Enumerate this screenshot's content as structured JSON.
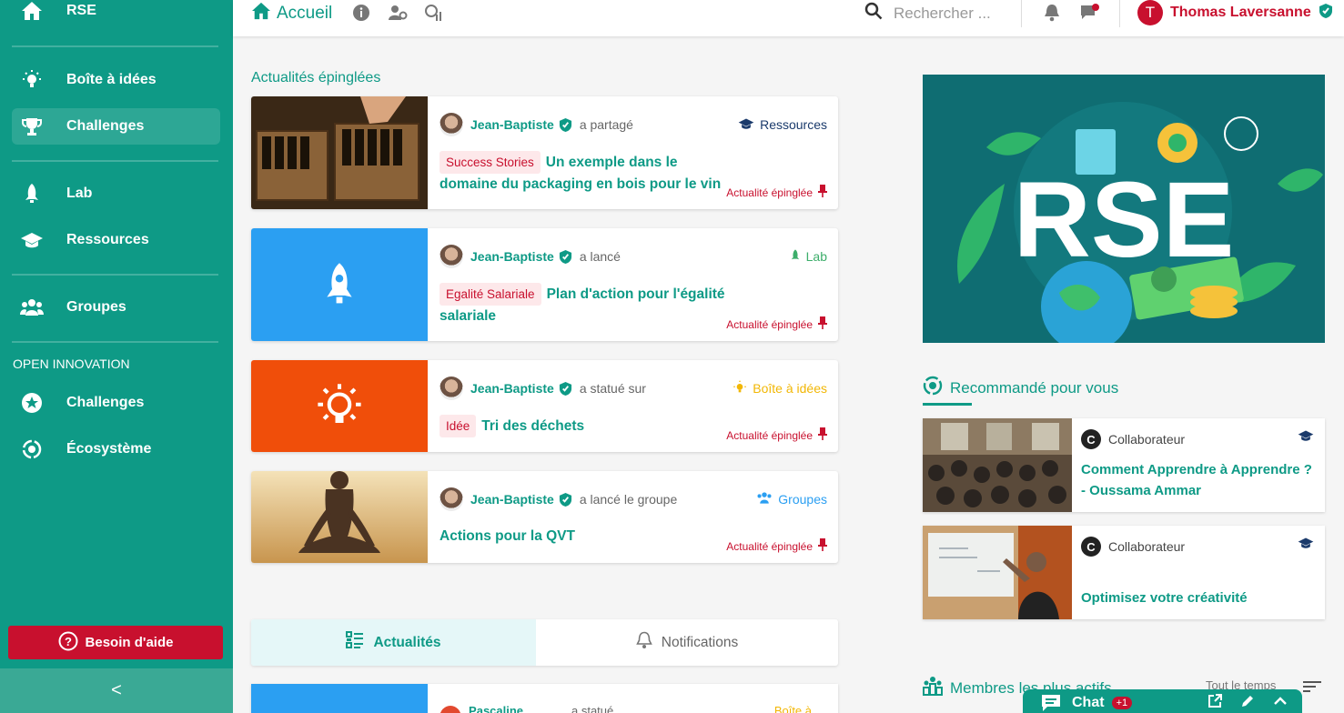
{
  "sidebar": {
    "title": "RSE",
    "items": [
      {
        "label": "Boîte à idées",
        "icon": "lightbulb-icon"
      },
      {
        "label": "Challenges",
        "icon": "trophy-icon"
      },
      {
        "label": "Lab",
        "icon": "rocket-icon"
      },
      {
        "label": "Ressources",
        "icon": "graduation-cap-icon"
      },
      {
        "label": "Groupes",
        "icon": "users-icon"
      }
    ],
    "section_label": "OPEN INNOVATION",
    "section_items": [
      {
        "label": "Challenges",
        "icon": "star-circle-icon"
      },
      {
        "label": "Écosystème",
        "icon": "ecosystem-icon"
      }
    ],
    "help_label": "Besoin d'aide",
    "collapse_glyph": "<"
  },
  "topbar": {
    "home_label": "Accueil",
    "search_placeholder": "Rechercher ...",
    "user_initial": "T",
    "user_name": "Thomas Laversanne"
  },
  "pinned": {
    "title": "Actualités épinglées",
    "pinned_label": "Actualité épinglée",
    "cards": [
      {
        "author": "Jean-Baptiste",
        "action": "a partagé",
        "category": "Ressources",
        "tag": "Success Stories",
        "title": "Un exemple dans le domaine du packaging en bois pour le vin"
      },
      {
        "author": "Jean-Baptiste",
        "action": "a lancé",
        "category": "Lab",
        "tag": "Egalité Salariale",
        "title": "Plan d'action pour l'égalité salariale"
      },
      {
        "author": "Jean-Baptiste",
        "action": "a statué sur",
        "category": "Boîte à idées",
        "tag": "Idée",
        "title": "Tri des déchets"
      },
      {
        "author": "Jean-Baptiste",
        "action": "a lancé le groupe",
        "category": "Groupes",
        "tag": "",
        "title": "Actions pour la QVT"
      }
    ]
  },
  "tabs": {
    "active": "Actualités",
    "inactive": "Notifications"
  },
  "peek": {
    "initial": "P",
    "author": "Pascaline RIVENO",
    "action": "a statué sur",
    "category": "Boîte à idées"
  },
  "banner": {
    "text": "RSE"
  },
  "recommended": {
    "title": "Recommandé pour vous",
    "items": [
      {
        "badge": "C",
        "category": "Collaborateur",
        "title": "Comment Apprendre à Apprendre ? - Oussama Ammar"
      },
      {
        "badge": "C",
        "category": "Collaborateur",
        "title": "Optimisez votre créativité"
      }
    ]
  },
  "members": {
    "title": "Membres les plus actifs",
    "filter": "Tout le temps"
  },
  "chat": {
    "label": "Chat",
    "badge": "+1"
  },
  "colors": {
    "primary": "#0e9a86",
    "danger": "#c8102e",
    "lab_green": "#3dae6b",
    "idea_yellow": "#f2b705",
    "group_blue": "#2b9ff2",
    "resource_navy": "#1a3a6b"
  }
}
